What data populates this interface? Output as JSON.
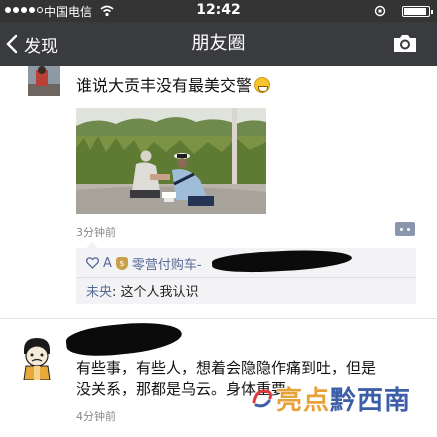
{
  "status_bar": {
    "carrier": "中国电信",
    "time": "12:42",
    "signal_icon": "signal-dots-icon",
    "wifi_icon": "wifi-icon",
    "battery_icon": "battery-icon"
  },
  "nav": {
    "back_label": "发现",
    "title": "朋友圈",
    "camera_icon": "camera-icon"
  },
  "posts": [
    {
      "text": "谁说大贡丰没有最美交警",
      "emoji": "grin-emoji",
      "time": "3分钟前",
      "likes": {
        "visible_prefix": "A",
        "visible_name": "零营付购车-"
      },
      "comments": [
        {
          "author": "未央",
          "text": "这个人我认识"
        }
      ]
    },
    {
      "text_lines": [
        "有些事，有些人，想着会隐隐作痛到吐，但是",
        "没关系，那都是乌云。身体重要"
      ],
      "time": "4分钟前"
    }
  ],
  "watermark": {
    "part_a": "亮点",
    "part_b": "黔西南"
  },
  "colors": {
    "status_bar": "#343434",
    "nav_bar": "#3a3b3f",
    "link_blue": "#576b95",
    "feedback_bg": "#f3f3f5"
  }
}
